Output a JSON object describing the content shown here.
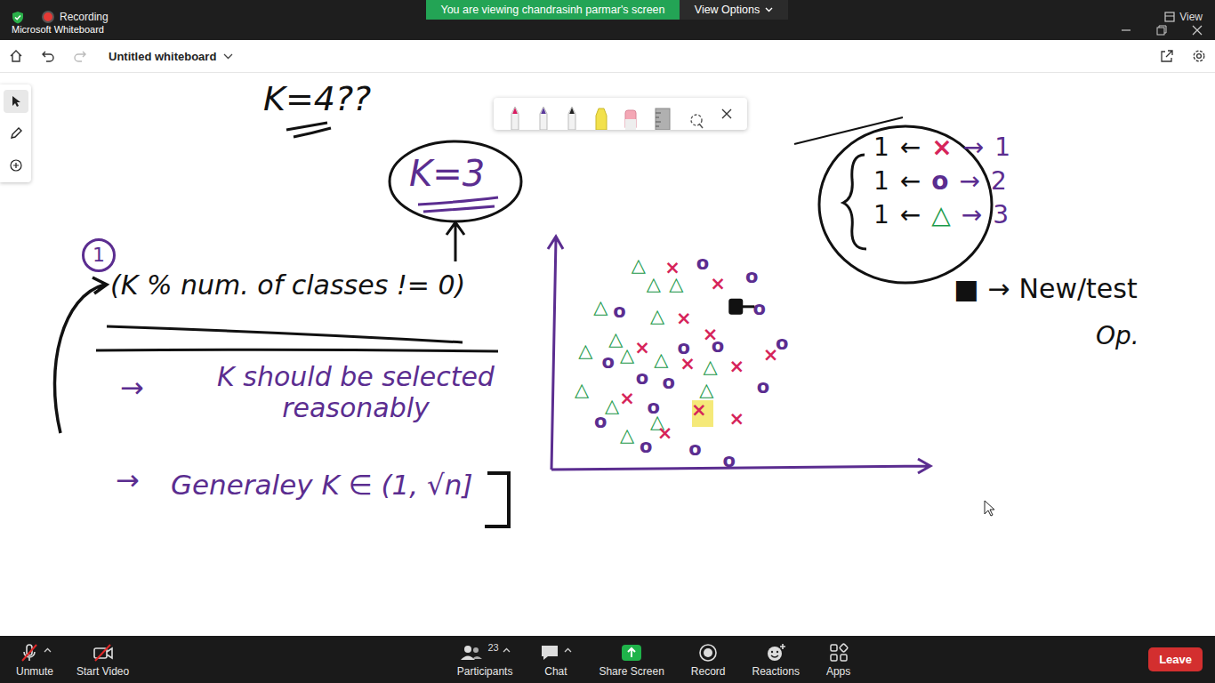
{
  "zoom_bar": {
    "recording": "Recording",
    "banner": "You are viewing chandrasinh parmar's screen",
    "view_options": "View Options",
    "view": "View"
  },
  "window": {
    "title": "Microsoft Whiteboard"
  },
  "toolbar": {
    "board_title": "Untitled whiteboard",
    "actions": [
      {
        "kind": "home",
        "disabled": false
      },
      {
        "kind": "undo",
        "disabled": false
      },
      {
        "kind": "redo",
        "disabled": true
      }
    ]
  },
  "tools": [
    {
      "kind": "select",
      "selected": true
    },
    {
      "kind": "pen",
      "selected": false
    },
    {
      "kind": "add",
      "selected": false
    }
  ],
  "pens": [
    {
      "kind": "pen",
      "color": "#d81b60"
    },
    {
      "kind": "pen",
      "color": "#5b3a9b"
    },
    {
      "kind": "pen",
      "color": "#222222"
    },
    {
      "kind": "highlighter",
      "color": "#f2e14c"
    },
    {
      "kind": "eraser",
      "color": "#f4a7b5"
    },
    {
      "kind": "ruler",
      "color": "#b0b0b0"
    },
    {
      "kind": "lasso",
      "color": "#555555"
    }
  ],
  "notes": {
    "question": "K=4??",
    "chosen": "K=3",
    "step": "1",
    "rule": "(K % num. of classes != 0)",
    "advice_arrow": "→",
    "advice": "K should be selected reasonably",
    "range_arrow": "→",
    "range": "Generaley K ∈ (1, √n]"
  },
  "legend": [
    {
      "count": "1",
      "left_arrow": "←",
      "symbol": "×",
      "color": "#d6245a",
      "right_arrow": "→",
      "label": "1"
    },
    {
      "count": "1",
      "left_arrow": "←",
      "symbol": "o",
      "color": "#5b2d90",
      "right_arrow": "→",
      "label": "2"
    },
    {
      "count": "1",
      "left_arrow": "←",
      "symbol": "△",
      "color": "#1a9a4a",
      "right_arrow": "→",
      "label": "3"
    }
  ],
  "test_note": {
    "symbol": "■",
    "arrow": "→",
    "text": "New/test",
    "text2": "Op."
  },
  "chart": {
    "series": [
      {
        "symbol": "△",
        "color": "#1a9a4a",
        "points": [
          [
            23,
            89
          ],
          [
            27,
            81
          ],
          [
            33,
            81
          ],
          [
            13,
            71
          ],
          [
            28,
            67
          ],
          [
            17,
            57
          ],
          [
            9,
            52
          ],
          [
            20,
            50
          ],
          [
            29,
            48
          ],
          [
            42,
            45
          ],
          [
            8,
            35
          ],
          [
            16,
            28
          ],
          [
            41,
            35
          ],
          [
            28,
            21
          ],
          [
            20,
            15
          ]
        ]
      },
      {
        "symbol": "×",
        "color": "#d6245a",
        "points": [
          [
            32,
            88
          ],
          [
            44,
            81
          ],
          [
            35,
            66
          ],
          [
            42,
            59
          ],
          [
            24,
            53
          ],
          [
            36,
            46
          ],
          [
            49,
            45
          ],
          [
            58,
            50
          ],
          [
            20,
            31
          ],
          [
            39,
            26
          ],
          [
            49,
            22
          ],
          [
            30,
            16
          ]
        ]
      },
      {
        "symbol": "o",
        "color": "#5b2d90",
        "points": [
          [
            40,
            90
          ],
          [
            53,
            84
          ],
          [
            18,
            69
          ],
          [
            55,
            70
          ],
          [
            35,
            53
          ],
          [
            44,
            54
          ],
          [
            61,
            55
          ],
          [
            15,
            47
          ],
          [
            24,
            40
          ],
          [
            31,
            38
          ],
          [
            56,
            36
          ],
          [
            13,
            21
          ],
          [
            27,
            27
          ],
          [
            25,
            10
          ],
          [
            38,
            9
          ],
          [
            47,
            4
          ]
        ]
      }
    ],
    "test_point": [
      49,
      71
    ],
    "highlight": [
      40,
      24
    ]
  },
  "meeting_controls": [
    {
      "kind": "mic",
      "label": "Unmute",
      "muted": true,
      "has_menu": true,
      "count": ""
    },
    {
      "kind": "video",
      "label": "Start Video",
      "muted": true,
      "has_menu": false,
      "count": ""
    },
    {
      "kind": "participants",
      "label": "Participants",
      "muted": false,
      "has_menu": true,
      "count": "23"
    },
    {
      "kind": "chat",
      "label": "Chat",
      "muted": false,
      "has_menu": true,
      "count": ""
    },
    {
      "kind": "share",
      "label": "Share Screen",
      "muted": false,
      "has_menu": false,
      "count": ""
    },
    {
      "kind": "record",
      "label": "Record",
      "muted": false,
      "has_menu": false,
      "count": ""
    },
    {
      "kind": "reactions",
      "label": "Reactions",
      "muted": false,
      "has_menu": false,
      "count": ""
    },
    {
      "kind": "apps",
      "label": "Apps",
      "muted": false,
      "has_menu": false,
      "count": ""
    }
  ],
  "leave": "Leave"
}
